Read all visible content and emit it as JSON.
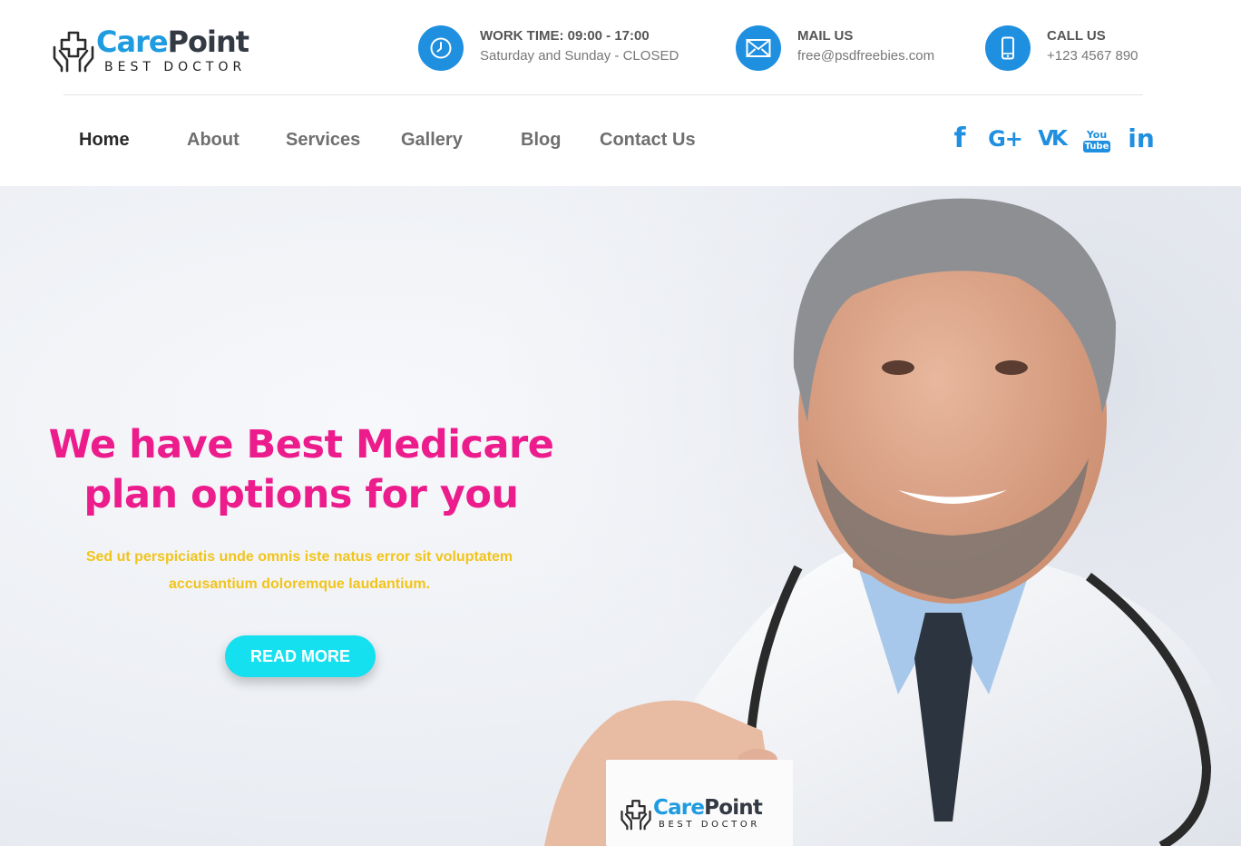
{
  "brand": {
    "name_part1": "Care",
    "name_part2": "Point",
    "tagline": "BEST DOCTOR"
  },
  "header_info": [
    {
      "icon": "clock-icon",
      "title": "WORK TIME: 09:00 - 17:00",
      "subtitle": "Saturday and Sunday - CLOSED"
    },
    {
      "icon": "envelope-icon",
      "title": "MAIL US",
      "subtitle": "free@psdfreebies.com"
    },
    {
      "icon": "phone-icon",
      "title": "CALL US",
      "subtitle": "+123 4567 890"
    }
  ],
  "nav": {
    "items": [
      {
        "label": "Home",
        "active": true
      },
      {
        "label": "About"
      },
      {
        "label": "Services"
      },
      {
        "label": "Gallery"
      },
      {
        "label": "Blog"
      },
      {
        "label": "Contact Us"
      }
    ]
  },
  "social": [
    {
      "icon": "facebook-icon",
      "text": "f"
    },
    {
      "icon": "google-plus-icon",
      "text": "G+"
    },
    {
      "icon": "vk-icon",
      "text": "VK"
    },
    {
      "icon": "youtube-icon",
      "text_top": "You",
      "text_bottom": "Tube"
    },
    {
      "icon": "linkedin-icon",
      "text": "in"
    }
  ],
  "hero": {
    "title_line1": "We have Best Medicare",
    "title_line2": "plan options for you",
    "subtitle_line1": "Sed ut perspiciatis unde omnis iste natus error sit voluptatem",
    "subtitle_line2": "accusantium doloremque laudantium.",
    "button_label": "READ MORE"
  },
  "colors": {
    "accent_blue": "#1f8fe0",
    "hero_title": "#ec1c8c",
    "hero_subtitle": "#f2c41a",
    "button": "#15e0f0"
  }
}
